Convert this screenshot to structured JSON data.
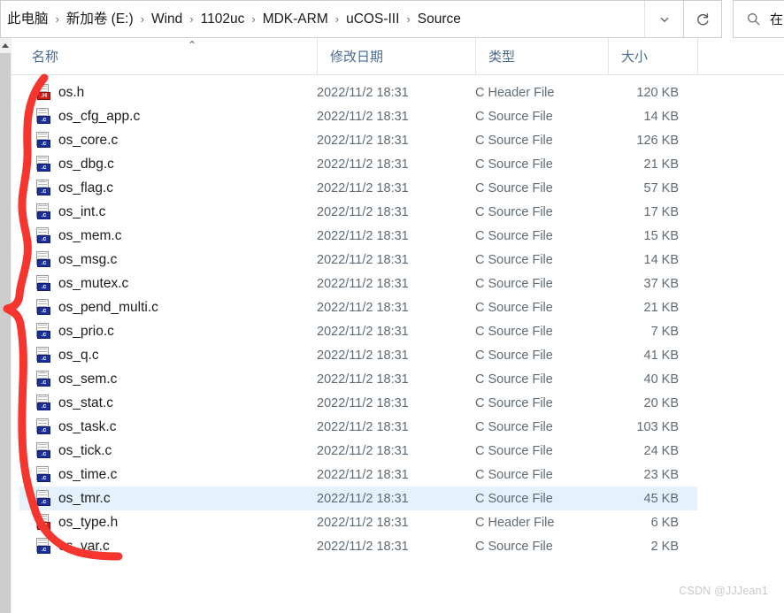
{
  "addressbar": {
    "breadcrumbs": [
      {
        "label": "此电脑"
      },
      {
        "label": "新加卷 (E:)"
      },
      {
        "label": "Wind"
      },
      {
        "label": "1102uc"
      },
      {
        "label": "MDK-ARM"
      },
      {
        "label": "uCOS-III"
      },
      {
        "label": "Source"
      }
    ],
    "separator": "›",
    "dropdown_icon": "chevron-down-icon",
    "refresh_icon": "refresh-icon",
    "search": {
      "icon": "search-icon",
      "text": "在"
    }
  },
  "columns": {
    "name": "名称",
    "date_modified": "修改日期",
    "type": "类型",
    "size": "大小",
    "sort_caret": "⌃"
  },
  "files": [
    {
      "name": "os.h",
      "date": "2022/11/2 18:31",
      "type": "C Header File",
      "size": "120 KB",
      "ext": "h",
      "selected": false
    },
    {
      "name": "os_cfg_app.c",
      "date": "2022/11/2 18:31",
      "type": "C Source File",
      "size": "14 KB",
      "ext": "c",
      "selected": false
    },
    {
      "name": "os_core.c",
      "date": "2022/11/2 18:31",
      "type": "C Source File",
      "size": "126 KB",
      "ext": "c",
      "selected": false
    },
    {
      "name": "os_dbg.c",
      "date": "2022/11/2 18:31",
      "type": "C Source File",
      "size": "21 KB",
      "ext": "c",
      "selected": false
    },
    {
      "name": "os_flag.c",
      "date": "2022/11/2 18:31",
      "type": "C Source File",
      "size": "57 KB",
      "ext": "c",
      "selected": false
    },
    {
      "name": "os_int.c",
      "date": "2022/11/2 18:31",
      "type": "C Source File",
      "size": "17 KB",
      "ext": "c",
      "selected": false
    },
    {
      "name": "os_mem.c",
      "date": "2022/11/2 18:31",
      "type": "C Source File",
      "size": "15 KB",
      "ext": "c",
      "selected": false
    },
    {
      "name": "os_msg.c",
      "date": "2022/11/2 18:31",
      "type": "C Source File",
      "size": "14 KB",
      "ext": "c",
      "selected": false
    },
    {
      "name": "os_mutex.c",
      "date": "2022/11/2 18:31",
      "type": "C Source File",
      "size": "37 KB",
      "ext": "c",
      "selected": false
    },
    {
      "name": "os_pend_multi.c",
      "date": "2022/11/2 18:31",
      "type": "C Source File",
      "size": "21 KB",
      "ext": "c",
      "selected": false
    },
    {
      "name": "os_prio.c",
      "date": "2022/11/2 18:31",
      "type": "C Source File",
      "size": "7 KB",
      "ext": "c",
      "selected": false
    },
    {
      "name": "os_q.c",
      "date": "2022/11/2 18:31",
      "type": "C Source File",
      "size": "41 KB",
      "ext": "c",
      "selected": false
    },
    {
      "name": "os_sem.c",
      "date": "2022/11/2 18:31",
      "type": "C Source File",
      "size": "40 KB",
      "ext": "c",
      "selected": false
    },
    {
      "name": "os_stat.c",
      "date": "2022/11/2 18:31",
      "type": "C Source File",
      "size": "20 KB",
      "ext": "c",
      "selected": false
    },
    {
      "name": "os_task.c",
      "date": "2022/11/2 18:31",
      "type": "C Source File",
      "size": "103 KB",
      "ext": "c",
      "selected": false
    },
    {
      "name": "os_tick.c",
      "date": "2022/11/2 18:31",
      "type": "C Source File",
      "size": "24 KB",
      "ext": "c",
      "selected": false
    },
    {
      "name": "os_time.c",
      "date": "2022/11/2 18:31",
      "type": "C Source File",
      "size": "23 KB",
      "ext": "c",
      "selected": false
    },
    {
      "name": "os_tmr.c",
      "date": "2022/11/2 18:31",
      "type": "C Source File",
      "size": "45 KB",
      "ext": "c",
      "selected": true
    },
    {
      "name": "os_type.h",
      "date": "2022/11/2 18:31",
      "type": "C Header File",
      "size": "6 KB",
      "ext": "h",
      "selected": false
    },
    {
      "name": "os_var.c",
      "date": "2022/11/2 18:31",
      "type": "C Source File",
      "size": "2 KB",
      "ext": "c",
      "selected": false
    }
  ],
  "icon_labels": {
    "c": ".c",
    "h": ".H"
  },
  "annotation": {
    "color": "#f5352e",
    "shape": "freehand-bracket"
  },
  "watermark": {
    "text": "CSDN @JJJean1"
  },
  "colors": {
    "header_text": "#4a6c90",
    "selection": "#e5f1fb",
    "c_icon": "#1b2e9e",
    "h_icon": "#d21b17",
    "annotation_red": "#f5352e"
  }
}
